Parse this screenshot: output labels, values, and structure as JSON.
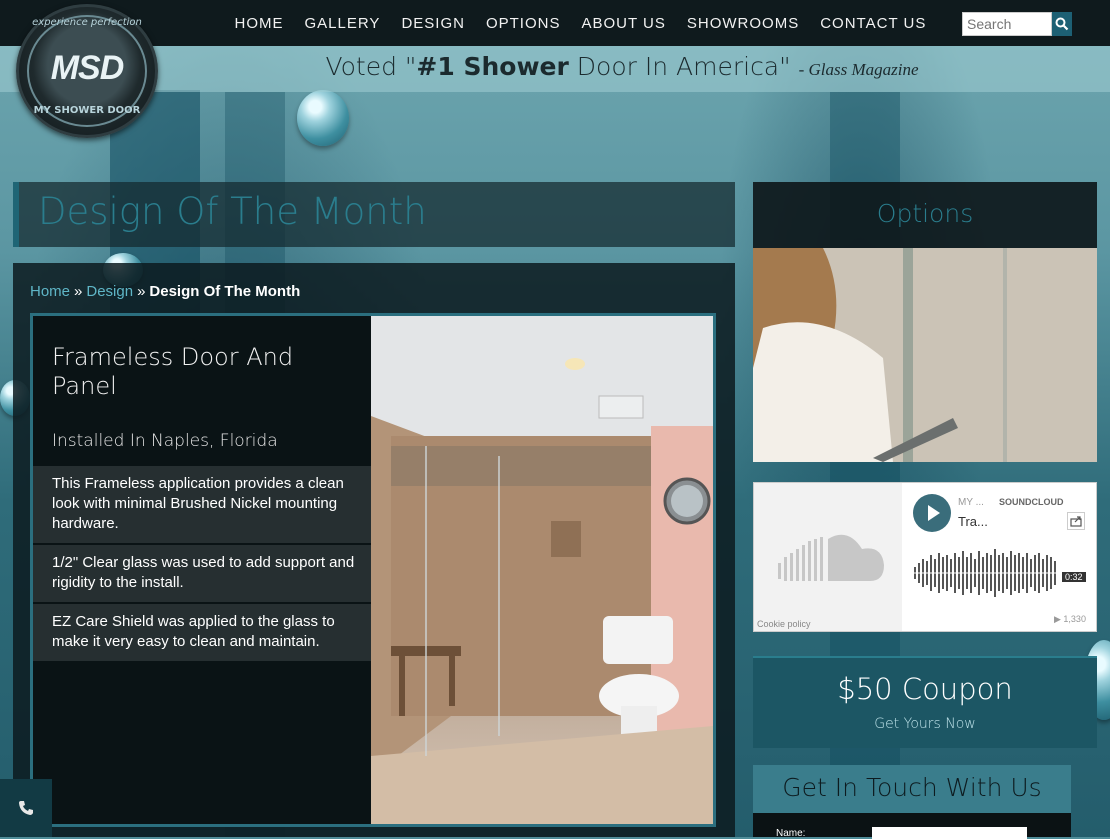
{
  "nav": {
    "items": [
      "HOME",
      "GALLERY",
      "DESIGN",
      "OPTIONS",
      "ABOUT US",
      "SHOWROOMS",
      "CONTACT US"
    ],
    "search_placeholder": "Search"
  },
  "logo": {
    "top_text": "experience perfection",
    "mark": "MSD",
    "bottom_text": "MY SHOWER DOOR"
  },
  "tagline": {
    "pre": "Voted \"",
    "bold": "#1 Shower",
    "post": " Door In America\"",
    "source": "- Glass Magazine"
  },
  "page_title": "Design Of The Month",
  "breadcrumb": {
    "home": "Home",
    "design": "Design",
    "current": "Design Of The Month",
    "separator": "»"
  },
  "feature": {
    "title": "Frameless Door And Panel",
    "location": "Installed In Naples, Florida",
    "points": [
      "This Frameless application provides a clean look with minimal Brushed Nickel mounting hardware.",
      "1/2\" Clear glass was used to add support and rigidity to the install.",
      "EZ Care Shield was applied to the glass to make it very easy to clean and maintain."
    ]
  },
  "sidebar": {
    "options_title": "Options",
    "soundcloud": {
      "artist": "MY ...",
      "brand": "SOUNDCLOUD",
      "track": "Tra...",
      "time": "0:32",
      "plays": "1,330",
      "cookie": "Cookie policy"
    },
    "coupon": {
      "title": "$50 Coupon",
      "subtitle": "Get Yours Now"
    },
    "contact": {
      "title": "Get In Touch With Us",
      "name_label": "Name:"
    }
  },
  "colors": {
    "accent": "#2a7d8d",
    "link": "#5fb6c7",
    "nav_bg": "#0f1a1d",
    "coupon_bg": "#1c5664"
  }
}
